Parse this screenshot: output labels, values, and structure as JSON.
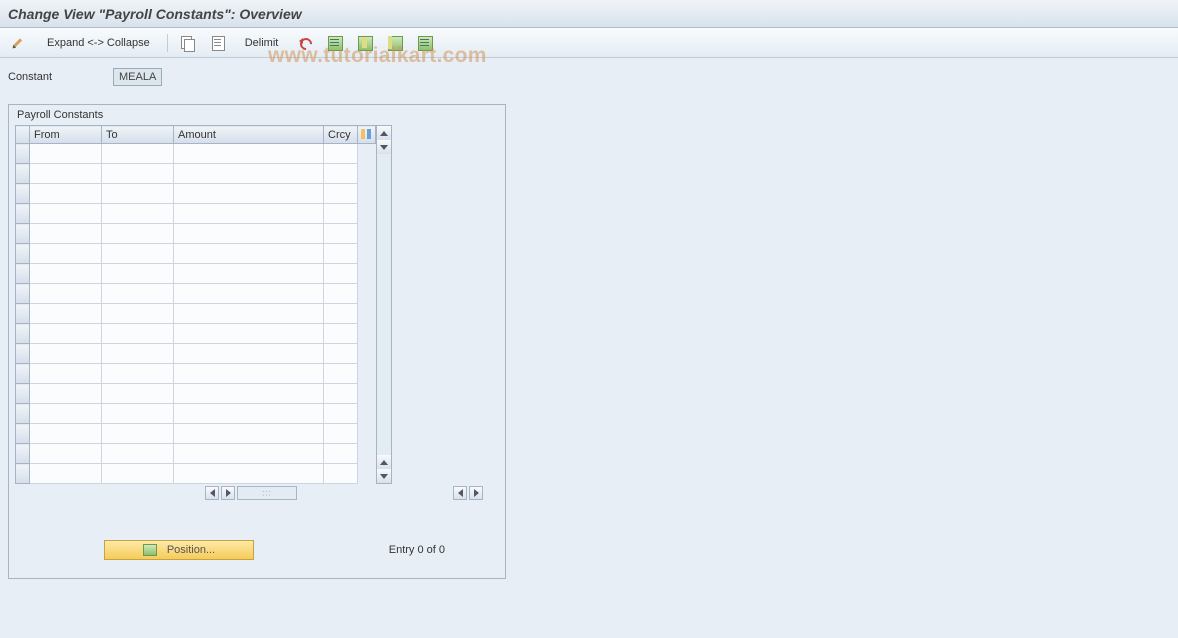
{
  "title": "Change View \"Payroll Constants\": Overview",
  "toolbar": {
    "expand_collapse_label": "Expand <-> Collapse",
    "delimit_label": "Delimit"
  },
  "field": {
    "label": "Constant",
    "value": "MEALA"
  },
  "group": {
    "title": "Payroll Constants",
    "columns": {
      "from": "From",
      "to": "To",
      "amount": "Amount",
      "crcy": "Crcy"
    },
    "position_label": "Position...",
    "entry_label": "Entry 0 of 0"
  },
  "watermark": "www.tutorialkart.com"
}
